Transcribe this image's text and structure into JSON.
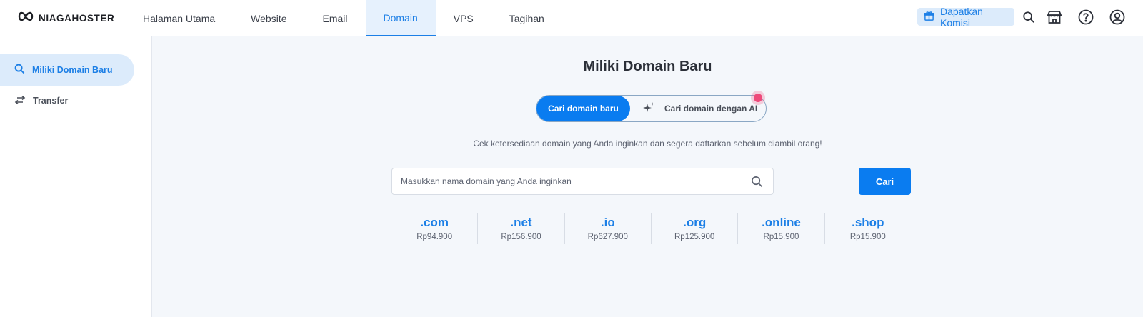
{
  "brand": {
    "name": "NIAGAHOSTER",
    "icon": "infinity-logo-icon"
  },
  "nav": [
    {
      "label": "Halaman Utama",
      "active": false
    },
    {
      "label": "Website",
      "active": false
    },
    {
      "label": "Email",
      "active": false
    },
    {
      "label": "Domain",
      "active": true
    },
    {
      "label": "VPS",
      "active": false
    },
    {
      "label": "Tagihan",
      "active": false
    }
  ],
  "header_actions": {
    "commission_label": "Dapatkan Komisi",
    "icons": [
      "gift-icon",
      "search-icon",
      "store-icon",
      "help-icon",
      "user-account-icon"
    ]
  },
  "sidebar": {
    "items": [
      {
        "label": "Miliki Domain Baru",
        "icon": "search-icon",
        "active": true
      },
      {
        "label": "Transfer",
        "icon": "transfer-arrows-icon",
        "active": false
      }
    ]
  },
  "main": {
    "title": "Miliki Domain Baru",
    "toggle": {
      "active_label": "Cari domain baru",
      "ai_label": "Cari domain dengan AI",
      "ai_icon": "sparkle-icon"
    },
    "subtitle": "Cek ketersediaan domain yang Anda inginkan dan segera daftarkan sebelum diambil orang!",
    "search": {
      "placeholder": "Masukkan nama domain yang Anda inginkan",
      "value": "",
      "button_label": "Cari"
    },
    "tlds": [
      {
        "name": ".com",
        "price": "Rp94.900"
      },
      {
        "name": ".net",
        "price": "Rp156.900"
      },
      {
        "name": ".io",
        "price": "Rp627.900"
      },
      {
        "name": ".org",
        "price": "Rp125.900"
      },
      {
        "name": ".online",
        "price": "Rp15.900"
      },
      {
        "name": ".shop",
        "price": "Rp15.900"
      }
    ]
  },
  "colors": {
    "accent": "#0a7cf0",
    "accent_text": "#1c7fe6",
    "accent_light": "#dcebfb",
    "background": "#f4f7fb",
    "notification_dot": "#ee4a7b"
  }
}
